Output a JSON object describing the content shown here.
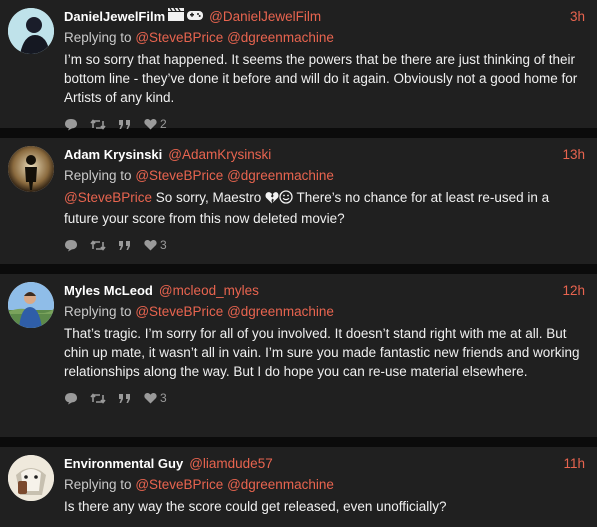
{
  "tweets": [
    {
      "name": "DanielJewelFilm",
      "handle": "@DanielJewelFilm",
      "time": "3h",
      "replying_label": "Replying to",
      "reply_to": [
        "@SteveBPrice",
        "@dgreenmachine"
      ],
      "text": "I’m so sorry that happened.  It seems the powers that be there are just thinking of their bottom line - they’ve done it before and will do it again. Obviously not a good home for Artists of any kind.",
      "likes": "2",
      "name_icons": [
        "clapperboard-icon",
        "video-game-icon"
      ]
    },
    {
      "name": "Adam Krysinski",
      "handle": "@AdamKrysinski",
      "time": "13h",
      "replying_label": "Replying to",
      "reply_to": [
        "@SteveBPrice",
        "@dgreenmachine"
      ],
      "text_mention": "@SteveBPrice",
      "text_before_emoji": " So sorry, Maestro ",
      "text_after_emoji": " There’s no chance for at least re-used in a future your score from this now deleted movie?",
      "likes": "3",
      "text_icons": [
        "broken-heart-icon",
        "smile-icon"
      ]
    },
    {
      "name": "Myles McLeod",
      "handle": "@mcleod_myles",
      "time": "12h",
      "replying_label": "Replying to",
      "reply_to": [
        "@SteveBPrice",
        "@dgreenmachine"
      ],
      "text": "That’s tragic. I’m sorry for all of you involved. It doesn’t stand right with me at all. But chin up mate, it wasn’t all in vain. I’m sure you made fantastic new friends and working relationships along the way. But I do hope you can re-use material elsewhere.",
      "likes": "3"
    },
    {
      "name": "Environmental Guy",
      "handle": "@liamdude57",
      "time": "11h",
      "replying_label": "Replying to",
      "reply_to": [
        "@SteveBPrice",
        "@dgreenmachine"
      ],
      "text": "Is there any way the score could get released, even unofficially?"
    }
  ],
  "colors": {
    "background": "#0b0b0b",
    "card": "#202020",
    "accent": "#e8644f",
    "name": "#ffffff",
    "icon": "#9a9a9a"
  }
}
